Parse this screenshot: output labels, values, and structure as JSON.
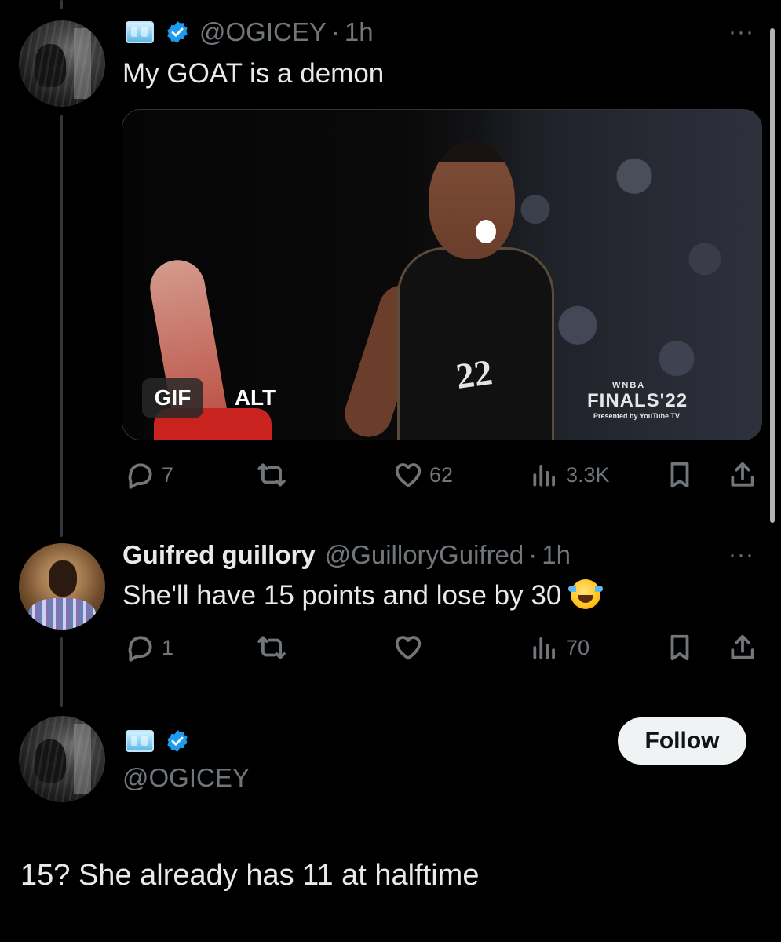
{
  "tweet1": {
    "handle": "@OGICEY",
    "sep": "·",
    "time": "1h",
    "text": "My GOAT is a demon",
    "media": {
      "gif_badge": "GIF",
      "alt_badge": "ALT",
      "jersey_number": "22",
      "overlay_brand": "WNBA",
      "overlay_title": "FINALS'22",
      "overlay_sponsor": "Presented by YouTube TV"
    },
    "actions": {
      "replies": "7",
      "likes": "62",
      "views": "3.3K"
    }
  },
  "reply": {
    "display_name": "Guifred guillory",
    "handle": "@GuilloryGuifred",
    "sep": "·",
    "time": "1h",
    "text": "She'll have 15 points and lose by 30",
    "actions": {
      "replies": "1",
      "views": "70"
    }
  },
  "quoted": {
    "handle": "@OGICEY",
    "follow_label": "Follow",
    "text": "15? She already has 11 at halftime"
  },
  "more_label": "···",
  "colors": {
    "background": "#000000",
    "text": "#e7e9ea",
    "muted": "#71767b",
    "verified": "#1d9bf0"
  }
}
